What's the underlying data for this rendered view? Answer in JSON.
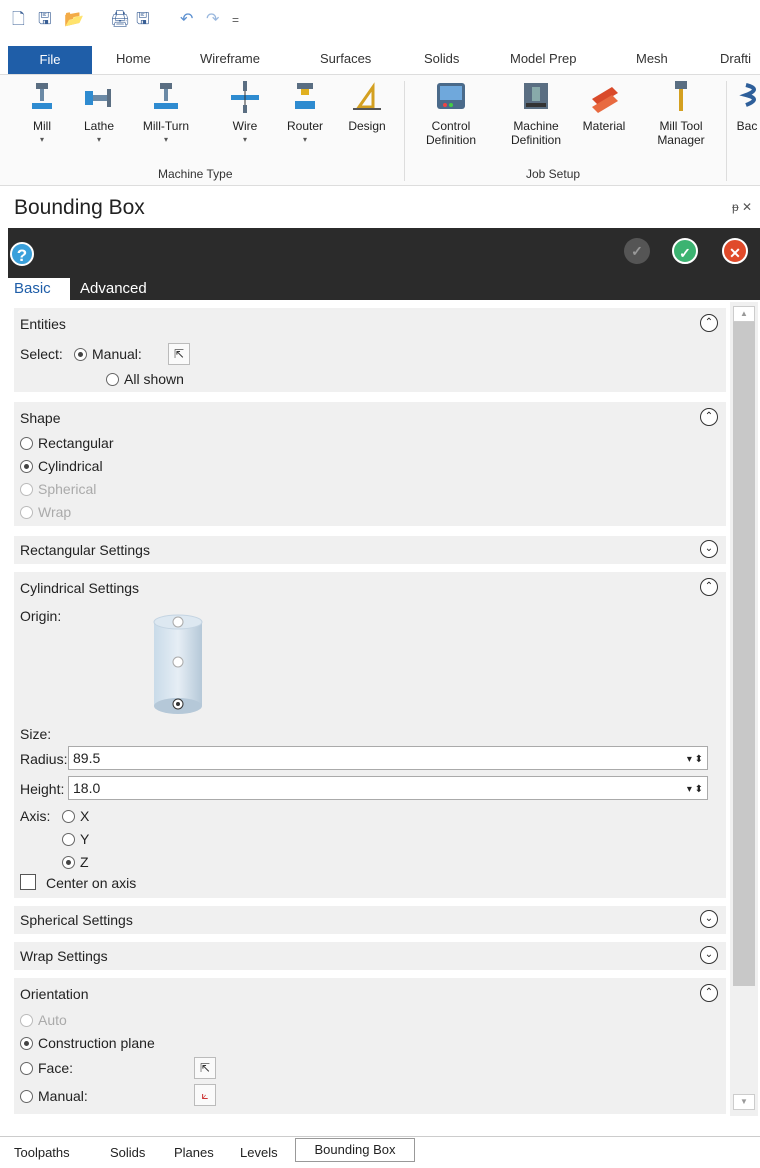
{
  "qat": {
    "new": "🗋",
    "save": "🖫",
    "open": "📂",
    "print": "🖨",
    "saveas": "🖫",
    "undo": "↶",
    "redo": "↷",
    "more": "="
  },
  "tabs": {
    "file": "File",
    "home": "Home",
    "wireframe": "Wireframe",
    "surfaces": "Surfaces",
    "solids": "Solids",
    "model_prep": "Model Prep",
    "mesh": "Mesh",
    "drafting": "Drafti"
  },
  "ribbon": {
    "mill": "Mill",
    "lathe": "Lathe",
    "mill_turn": "Mill-Turn",
    "wire": "Wire",
    "router": "Router",
    "design": "Design",
    "control_1": "Control",
    "control_2": "Definition",
    "machine_1": "Machine",
    "machine_2": "Definition",
    "material": "Material",
    "mtm_1": "Mill Tool",
    "mtm_2": "Manager",
    "back": "Bac",
    "group_machine_type": "Machine Type",
    "group_job_setup": "Job Setup"
  },
  "panel": {
    "title": "Bounding Box",
    "pin": "ᵽ ✕",
    "help": "?",
    "basic": "Basic",
    "advanced": "Advanced"
  },
  "entities": {
    "header": "Entities",
    "select": "Select:",
    "manual": "Manual:",
    "all_shown": "All shown"
  },
  "shape": {
    "header": "Shape",
    "rect": "Rectangular",
    "cyl": "Cylindrical",
    "sph": "Spherical",
    "wrap": "Wrap"
  },
  "rect_settings": "Rectangular Settings",
  "cyl_settings": {
    "header": "Cylindrical Settings",
    "origin": "Origin:",
    "size": "Size:",
    "radius_label": "Radius:",
    "radius": "89.5",
    "height_label": "Height:",
    "height": "18.0",
    "axis": "Axis:",
    "x": "X",
    "y": "Y",
    "z": "Z",
    "center": "Center on axis"
  },
  "sph_settings": "Spherical Settings",
  "wrap_settings": "Wrap Settings",
  "orientation": {
    "header": "Orientation",
    "auto": "Auto",
    "cplane": "Construction plane",
    "face": "Face:",
    "manual": "Manual:"
  },
  "bottom_tabs": {
    "toolpaths": "Toolpaths",
    "solids": "Solids",
    "planes": "Planes",
    "levels": "Levels",
    "bbox": "Bounding Box"
  },
  "colors": {
    "accent": "#1f5ea8",
    "ok": "#3cb371",
    "cancel": "#e04a2a"
  }
}
